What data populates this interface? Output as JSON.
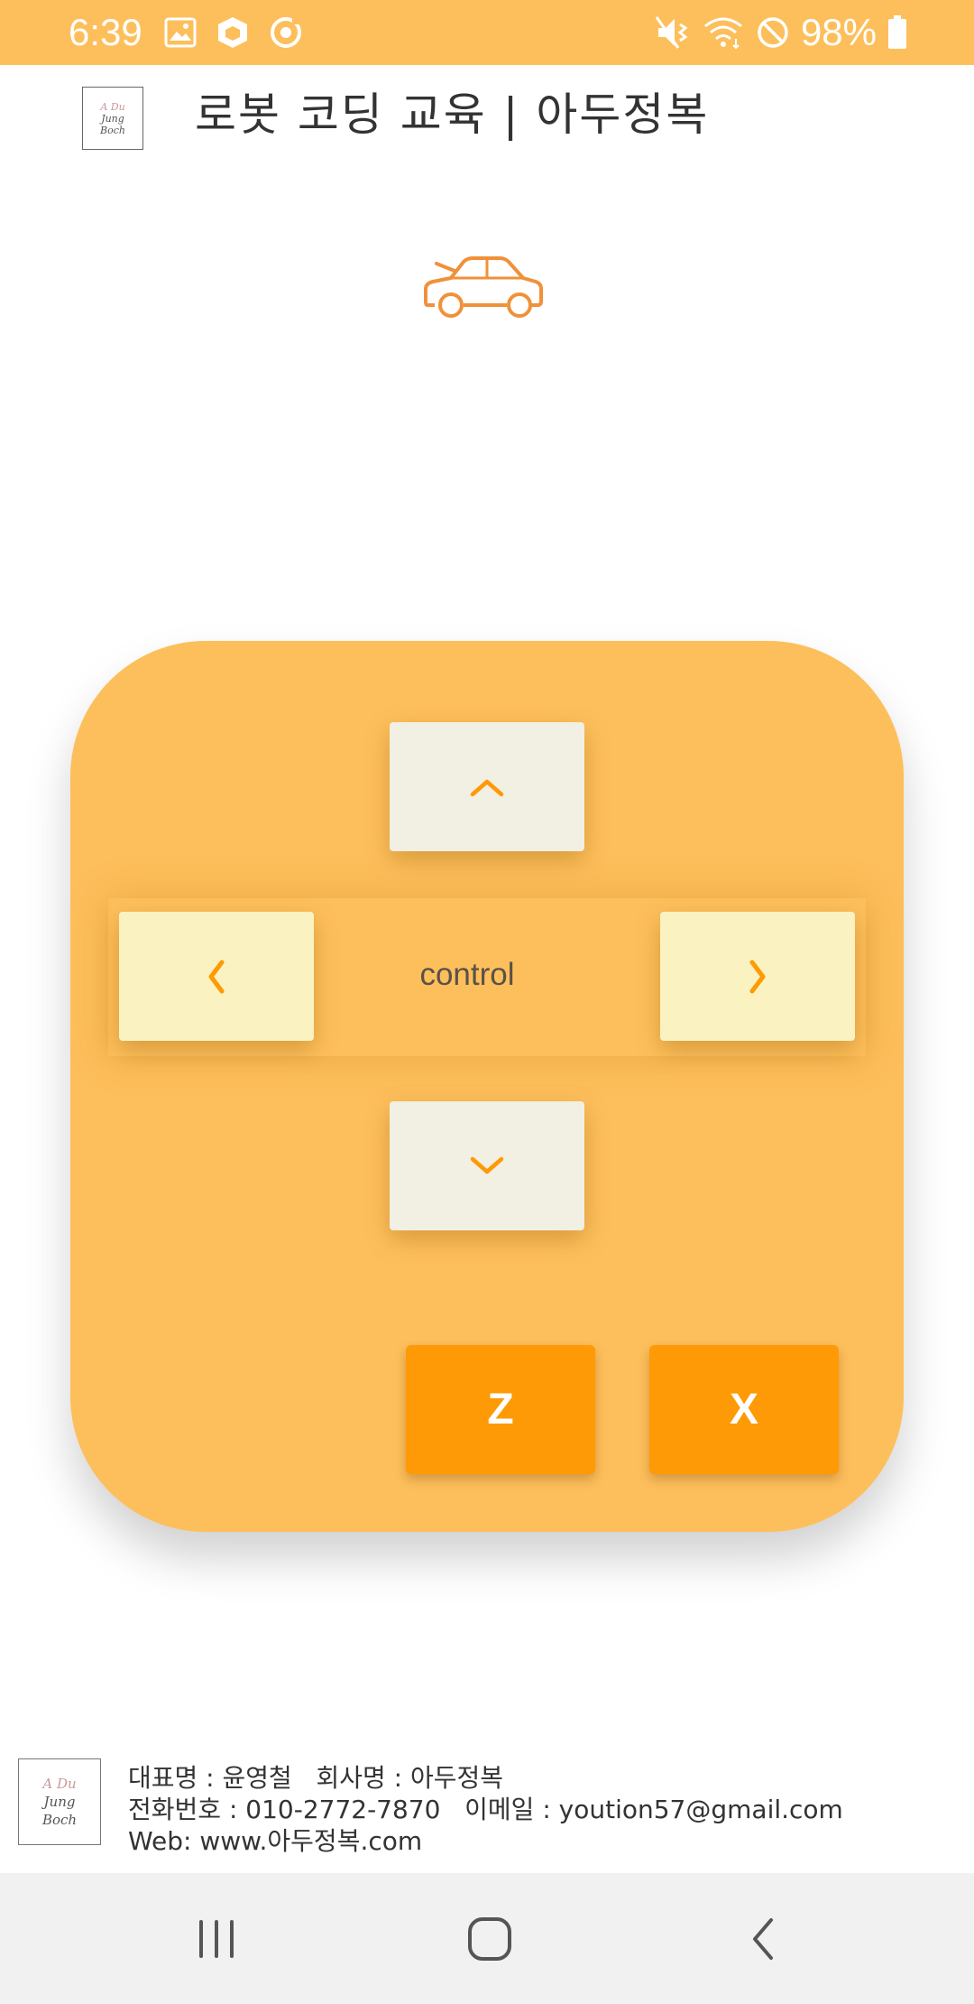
{
  "status_bar": {
    "time": "6:39",
    "battery": "98%",
    "left_icons": [
      "image-icon",
      "box-icon",
      "sync-icon"
    ],
    "right_icons": [
      "mute-vibrate-icon",
      "wifi-icon",
      "no-disturb-icon",
      "battery-icon"
    ]
  },
  "header": {
    "title": "로봇 코딩 교육 | 아두정복",
    "logo_lines": [
      "A Du",
      "Jung",
      "Boch"
    ]
  },
  "car_icon": "car-icon",
  "controller": {
    "center_label": "control",
    "up_icon": "chevron-up-icon",
    "down_icon": "chevron-down-icon",
    "left_icon": "chevron-left-icon",
    "right_icon": "chevron-right-icon",
    "z_label": "Z",
    "x_label": "X"
  },
  "footer": {
    "logo_lines": [
      "A Du",
      "Jung",
      "Boch"
    ],
    "line1": "대표명 : 윤영철   회사명 : 아두정복",
    "line2": "전화번호 : 010-2772-7870   이메일 : yoution57@gmail.com",
    "line3": "Web: www.아두정복.com"
  },
  "nav_bar": {
    "icons": [
      "recent-apps-icon",
      "home-icon",
      "back-icon"
    ]
  },
  "colors": {
    "status_bar": "#fdbf5b",
    "controller_bg": "#fdbf5b",
    "accent": "#fd9a05",
    "vertical_button": "#f2efe3",
    "horizontal_button": "#faf2c0",
    "car_icon": "#f0913a"
  }
}
